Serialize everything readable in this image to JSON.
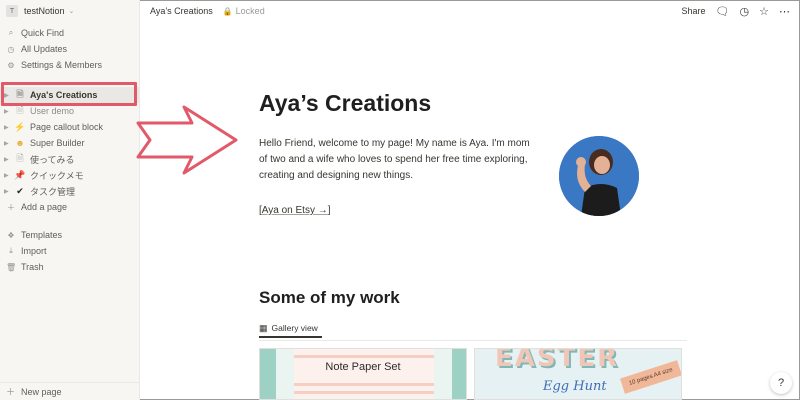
{
  "workspace": {
    "avatar_letter": "T",
    "name": "testNotion",
    "chevron": "⌃⌄"
  },
  "sidebar": {
    "nav": [
      {
        "label": "Quick Find",
        "icon": "search-icon"
      },
      {
        "label": "All Updates",
        "icon": "clock-icon"
      },
      {
        "label": "Settings & Members",
        "icon": "gear-icon"
      }
    ],
    "pages": [
      {
        "label": "Aya's Creations",
        "icon": "document-icon",
        "active": true
      },
      {
        "label": "User demo",
        "icon": "document-icon"
      },
      {
        "label": "Page callout block",
        "icon": "lightning-icon"
      },
      {
        "label": "Super Builder",
        "icon": "smiley-icon"
      },
      {
        "label": "使ってみる",
        "icon": "document-icon"
      },
      {
        "label": "クイックメモ",
        "icon": "pin-icon"
      },
      {
        "label": "タスク管理",
        "icon": "check-icon"
      }
    ],
    "add_page": "Add a page",
    "tools": [
      {
        "label": "Templates",
        "icon": "templates-icon"
      },
      {
        "label": "Import",
        "icon": "import-icon"
      },
      {
        "label": "Trash",
        "icon": "trash-icon"
      }
    ],
    "new_page": "New page"
  },
  "topbar": {
    "breadcrumb": "Aya’s Creations",
    "locked": "Locked",
    "share": "Share"
  },
  "page": {
    "title": "Aya’s Creations",
    "intro": "Hello Friend, welcome to my page! My name is Aya. I'm mom of two and a wife who loves to spend her free time exploring, creating and designing new things.",
    "etsy_open": "[",
    "etsy_link": "Aya on Etsy →",
    "etsy_close": "]",
    "work_heading": "Some of my work",
    "gallery_tab": "Gallery view",
    "card1_title": "Note Paper Set",
    "card2_title": "EASTER",
    "card2_subtitle": "Egg Hunt",
    "card2_ribbon": "10 pages A4 size"
  },
  "help": "?",
  "colors": {
    "highlight": "#e25a6a",
    "sidebar_bg": "#f7f6f3",
    "avatar_bg": "#3b78c4"
  }
}
